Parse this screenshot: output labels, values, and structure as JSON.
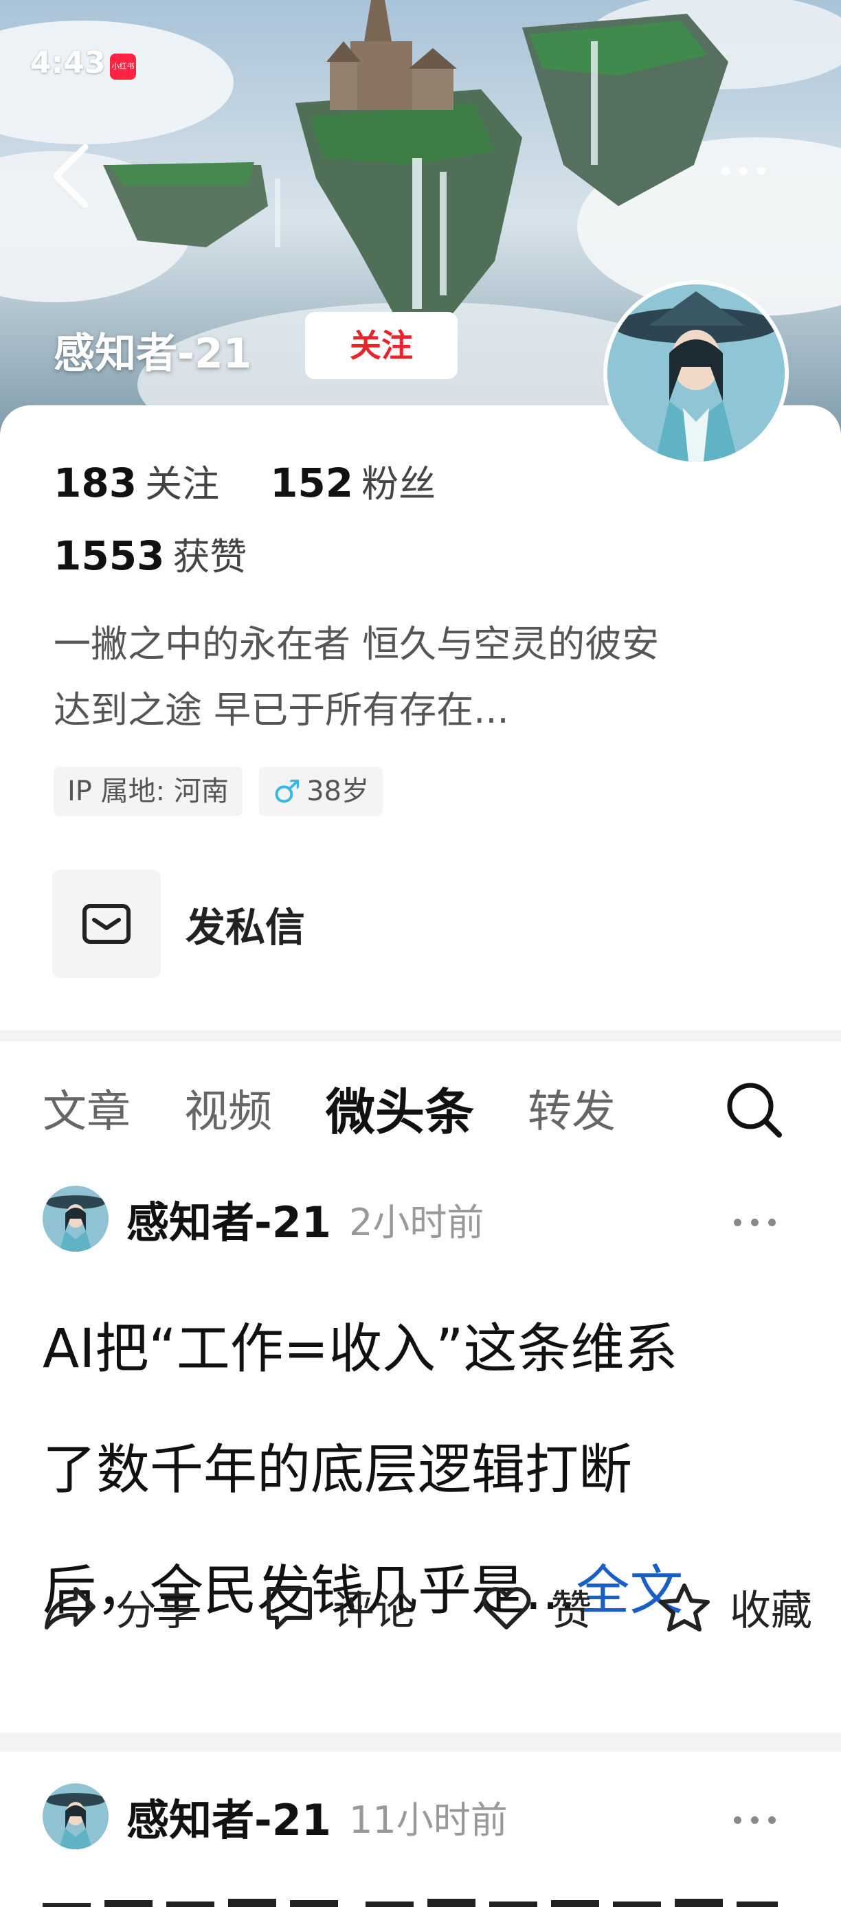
{
  "status_bar": {
    "time": "4:43",
    "app_badge": "小红书"
  },
  "header": {
    "name": "感知者-21",
    "follow_label": "关注"
  },
  "stats": [
    {
      "value": "183",
      "label": "关注"
    },
    {
      "value": "152",
      "label": "粉丝"
    },
    {
      "value": "1553",
      "label": "获赞"
    }
  ],
  "bio": {
    "line1": "一撇之中的永在者  恒久与空灵的彼安",
    "line2": "达到之途 早已于所有存在..."
  },
  "tags": {
    "location": "IP 属地: 河南",
    "gender_icon": "male-icon",
    "age": "38岁"
  },
  "message_button": {
    "label": "发私信",
    "icon": "envelope-icon"
  },
  "tabs": [
    {
      "label": "文章",
      "active": false
    },
    {
      "label": "视频",
      "active": false
    },
    {
      "label": "微头条",
      "active": true
    },
    {
      "label": "转发",
      "active": false
    }
  ],
  "posts": [
    {
      "author": "感知者-21",
      "time": "2小时前",
      "line1": "AI把“工作=收入”这条维系",
      "line2": "了数千年的底层逻辑打断",
      "line3": "后，全民发钱几乎是...",
      "full_link": "全文",
      "actions": {
        "share": "分享",
        "comment": "评论",
        "like": "赞",
        "favorite": "收藏"
      }
    },
    {
      "author": "感知者-21",
      "time": "11小时前"
    }
  ],
  "colors": {
    "follow_text": "#e8242c",
    "link_blue": "#1a5fc9",
    "gender_blue": "#38b6e9",
    "badge_red": "#ff2442"
  }
}
